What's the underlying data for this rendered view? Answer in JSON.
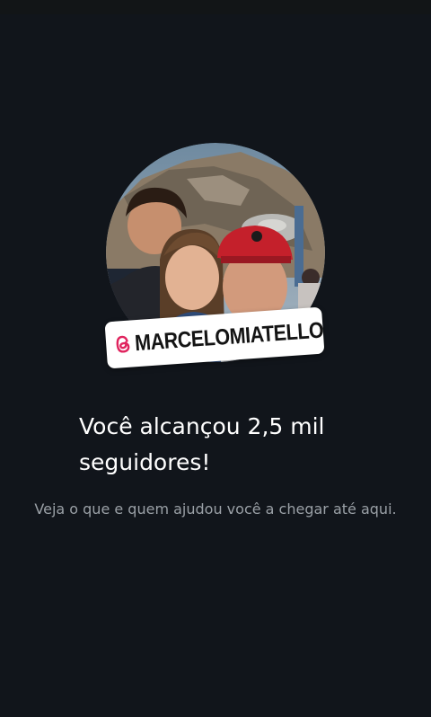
{
  "profile": {
    "username": "MARCELOMIATELLO",
    "platform_icon": "threads-icon",
    "avatar": "profile-photo"
  },
  "milestone": {
    "headline": "Você alcançou 2,5 mil seguidores!",
    "subtitle": "Veja o que e quem ajudou você a chegar até aqui."
  },
  "colors": {
    "background": "#11151b",
    "headline": "#ffffff",
    "subtitle": "#9aa0a6",
    "sticker": "#ffffff",
    "threads_icon": "#e0245e"
  }
}
